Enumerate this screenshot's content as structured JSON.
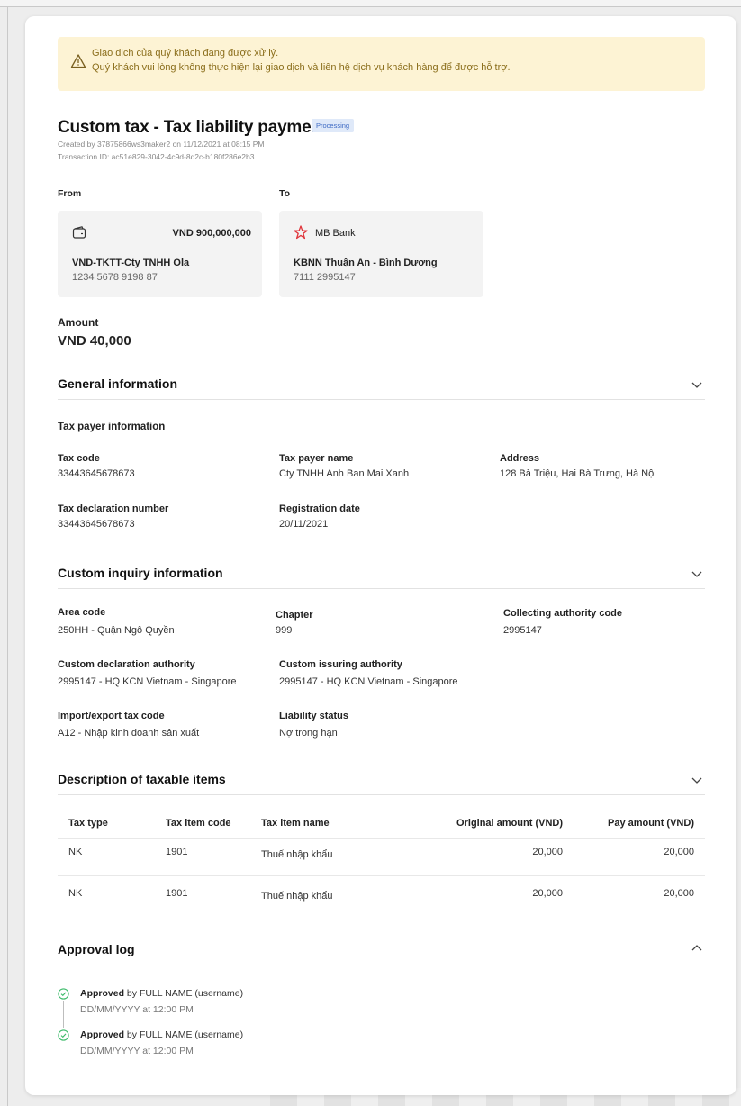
{
  "alert": {
    "line1": "Giao dịch của quý khách đang được xử lý.",
    "line2": "Quý khách vui lòng không thực hiện lại giao dịch và liên hệ dịch vụ khách hàng để được hỗ trợ.",
    "icon": "warning-icon"
  },
  "header": {
    "title": "Custom tax - Tax liability payment",
    "status": "Processing",
    "created": "Created by 37875866ws3maker2 on 11/12/2021 at 08:15 PM",
    "transaction": "Transaction ID: ac51e829-3042-4c9d-8d2c-b180f286e2b3"
  },
  "from": {
    "label": "From",
    "amount": "VND 900,000,000",
    "name": "VND-TKTT-Cty TNHH Ola",
    "number": "1234 5678 9198 87",
    "icon": "wallet-icon"
  },
  "to": {
    "label": "To",
    "bank": "MB Bank",
    "name": "KBNN Thuận An - Bình Dương",
    "number": "7111 2995147",
    "icon": "mb-bank-logo-icon"
  },
  "amount": {
    "label": "Amount",
    "value": "VND 40,000"
  },
  "general": {
    "title": "General information",
    "subtitle": "Tax payer information",
    "fields": [
      {
        "label": "Tax code",
        "value": "33443645678673"
      },
      {
        "label": "Tax payer name",
        "value": "Cty TNHH Anh Ban Mai Xanh"
      },
      {
        "label": "Address",
        "value": "128 Bà Triệu, Hai Bà Trưng, Hà Nội"
      },
      {
        "label": "Tax declaration number",
        "value": "33443645678673"
      },
      {
        "label": "Registration date",
        "value": "20/11/2021"
      }
    ]
  },
  "custom": {
    "title": "Custom inquiry information",
    "fields": [
      {
        "label": "Area code",
        "value": "250HH - Quận Ngô Quyền"
      },
      {
        "label": "Chapter",
        "value": "999"
      },
      {
        "label": "Collecting authority code",
        "value": "2995147"
      },
      {
        "label": "Custom declaration authority",
        "value": "2995147 - HQ KCN Vietnam - Singapore"
      },
      {
        "label": "Custom issuring authority",
        "value": "2995147 - HQ KCN Vietnam - Singapore"
      },
      {
        "label": "Import/export tax code",
        "value": "A12 - Nhập kinh doanh sản xuất"
      },
      {
        "label": "Liability status",
        "value": "Nợ trong hạn"
      }
    ]
  },
  "items": {
    "title": "Description of taxable items",
    "columns": [
      "Tax type",
      "Tax item code",
      "Tax item name",
      "Original amount (VND)",
      "Pay amount (VND)"
    ],
    "rows": [
      [
        "NK",
        "1901",
        "Thuế nhập khẩu",
        "20,000",
        "20,000"
      ],
      [
        "NK",
        "1901",
        "Thuế nhập khẩu",
        "20,000",
        "20,000"
      ]
    ]
  },
  "log": {
    "title": "Approval log",
    "entries": [
      {
        "status": "Approved",
        "by": " by FULL NAME (username)",
        "date": "DD/MM/YYYY at 12:00 PM"
      },
      {
        "status": "Approved",
        "by": " by FULL NAME (username)",
        "date": "DD/MM/YYYY at 12:00 PM"
      }
    ]
  },
  "colors": {
    "alert_bg": "#fdf3d4",
    "alert_text": "#8a6d1a",
    "badge_bg": "#dfe9f9",
    "badge_text": "#3f6bc4",
    "success": "#3dbb6a",
    "mb_red": "#e0353b"
  }
}
